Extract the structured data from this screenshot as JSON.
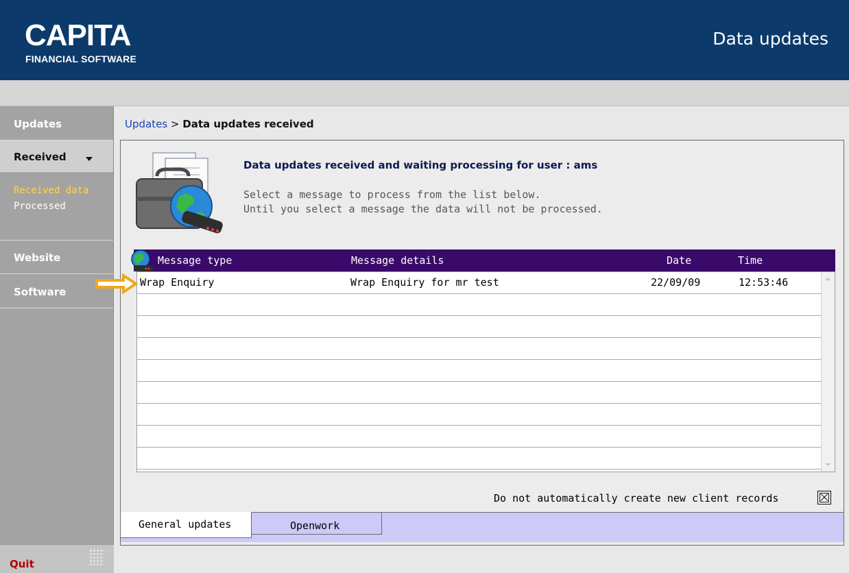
{
  "header": {
    "logo_main": "CAPITA",
    "logo_sub": "FINANCIAL SOFTWARE",
    "title": "Data updates"
  },
  "sidebar": {
    "updates": "Updates",
    "received": "Received",
    "received_sub": [
      "Received data",
      "Processed"
    ],
    "website": "Website",
    "software": "Software",
    "quit": "Quit"
  },
  "breadcrumb": {
    "link": "Updates",
    "separator": ">",
    "current": "Data updates received"
  },
  "intro": {
    "title": "Data updates received and waiting processing for user : ams",
    "line1": "Select a message to process from the list below.",
    "line2": "Until you select a message the data will not be processed."
  },
  "table": {
    "columns": [
      "Message type",
      "Message details",
      "Date",
      "Time"
    ],
    "rows": [
      {
        "type": "Wrap Enquiry",
        "details": "Wrap Enquiry for mr test",
        "date": "22/09/09",
        "time": "12:53:46"
      }
    ]
  },
  "options": {
    "no_auto_create_label": "Do not automatically create new client records",
    "no_auto_create_checked": true
  },
  "tabs": [
    "General updates",
    "Openwork"
  ],
  "icons": {
    "header_illustration": "briefcase-globe-icon",
    "table_header": "globe-modem-icon",
    "row_pointer": "arrow-right-icon",
    "resize_grip": "grip-icon"
  },
  "colors": {
    "header_bg": "#0c3a6a",
    "table_header_bg": "#3a0a6a",
    "tab_strip_bg": "#cccaf7",
    "active_sub_item": "#ffd54a",
    "quit": "#b30000",
    "arrow": "#f0a81c"
  }
}
